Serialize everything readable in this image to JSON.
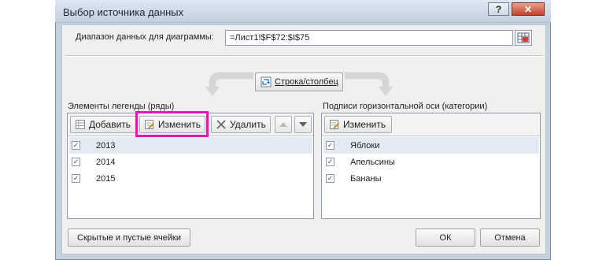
{
  "dialog": {
    "title": "Выбор источника данных",
    "help_glyph": "?",
    "close_glyph": "✕"
  },
  "range": {
    "label": "Диапазон данных для диаграммы:",
    "value": "=Лист1!$F$72:$I$75"
  },
  "switch_button": "Строка/столбец",
  "legend": {
    "title": "Элементы легенды (ряды)",
    "add": "Добавить",
    "edit": "Изменить",
    "delete": "Удалить",
    "items": [
      {
        "label": "2013",
        "checked": true
      },
      {
        "label": "2014",
        "checked": true
      },
      {
        "label": "2015",
        "checked": true
      }
    ]
  },
  "axis": {
    "title": "Подписи горизонтальной оси (категории)",
    "edit": "Изменить",
    "items": [
      {
        "label": "Яблоки",
        "checked": true
      },
      {
        "label": "Апельсины",
        "checked": true
      },
      {
        "label": "Бананы",
        "checked": true
      }
    ]
  },
  "footer": {
    "hidden_cells": "Скрытые и пустые ячейки",
    "ok": "ОК",
    "cancel": "Отмена"
  },
  "colors": {
    "highlight": "#e316b6",
    "check_mark": "#3d4f80"
  }
}
